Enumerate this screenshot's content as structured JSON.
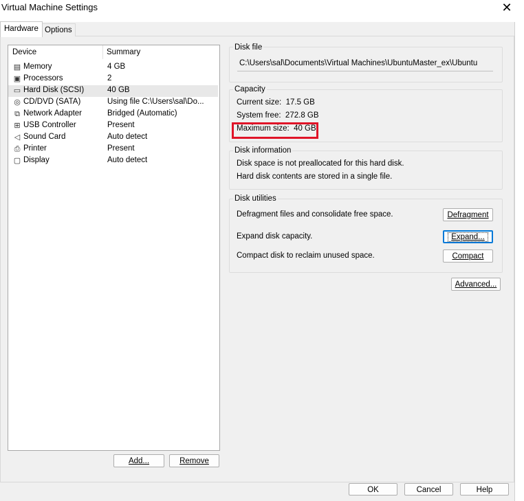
{
  "window": {
    "title": "Virtual Machine Settings"
  },
  "tabs": [
    {
      "label": "Hardware"
    },
    {
      "label": "Options"
    }
  ],
  "device_list": {
    "columns": [
      "Device",
      "Summary"
    ],
    "rows": [
      {
        "icon": "memory-icon",
        "name": "Memory",
        "summary": "4 GB"
      },
      {
        "icon": "processor-icon",
        "name": "Processors",
        "summary": "2"
      },
      {
        "icon": "hard-disk-icon",
        "name": "Hard Disk (SCSI)",
        "summary": "40 GB",
        "selected": true
      },
      {
        "icon": "cd-dvd-icon",
        "name": "CD/DVD (SATA)",
        "summary": "Using file C:\\Users\\sal\\Do..."
      },
      {
        "icon": "network-adapter-icon",
        "name": "Network Adapter",
        "summary": "Bridged (Automatic)"
      },
      {
        "icon": "usb-icon",
        "name": "USB Controller",
        "summary": "Present"
      },
      {
        "icon": "sound-card-icon",
        "name": "Sound Card",
        "summary": "Auto detect"
      },
      {
        "icon": "printer-icon",
        "name": "Printer",
        "summary": "Present"
      },
      {
        "icon": "display-icon",
        "name": "Display",
        "summary": "Auto detect"
      }
    ],
    "add_label": "Add...",
    "remove_label": "Remove"
  },
  "disk_file": {
    "label": "Disk file",
    "path": "C:\\Users\\sal\\Documents\\Virtual Machines\\UbuntuMaster_ex\\Ubuntu"
  },
  "capacity": {
    "label": "Capacity",
    "current": "Current size:  17.5 GB",
    "system_free": "System free:  272.8 GB",
    "maximum": "Maximum size:  40 GB"
  },
  "disk_information": {
    "label": "Disk information",
    "line1": "Disk space is not preallocated for this hard disk.",
    "line2": "Hard disk contents are stored in a single file."
  },
  "disk_utilities": {
    "label": "Disk utilities",
    "defrag_text": "Defragment files and consolidate free space.",
    "defrag_button": "Defragment",
    "expand_text": "Expand disk capacity.",
    "expand_button": "Expand...",
    "compact_text": "Compact disk to reclaim unused space.",
    "compact_button": "Compact"
  },
  "advanced_button": "Advanced...",
  "footer": {
    "ok": "OK",
    "cancel": "Cancel",
    "help": "Help"
  }
}
